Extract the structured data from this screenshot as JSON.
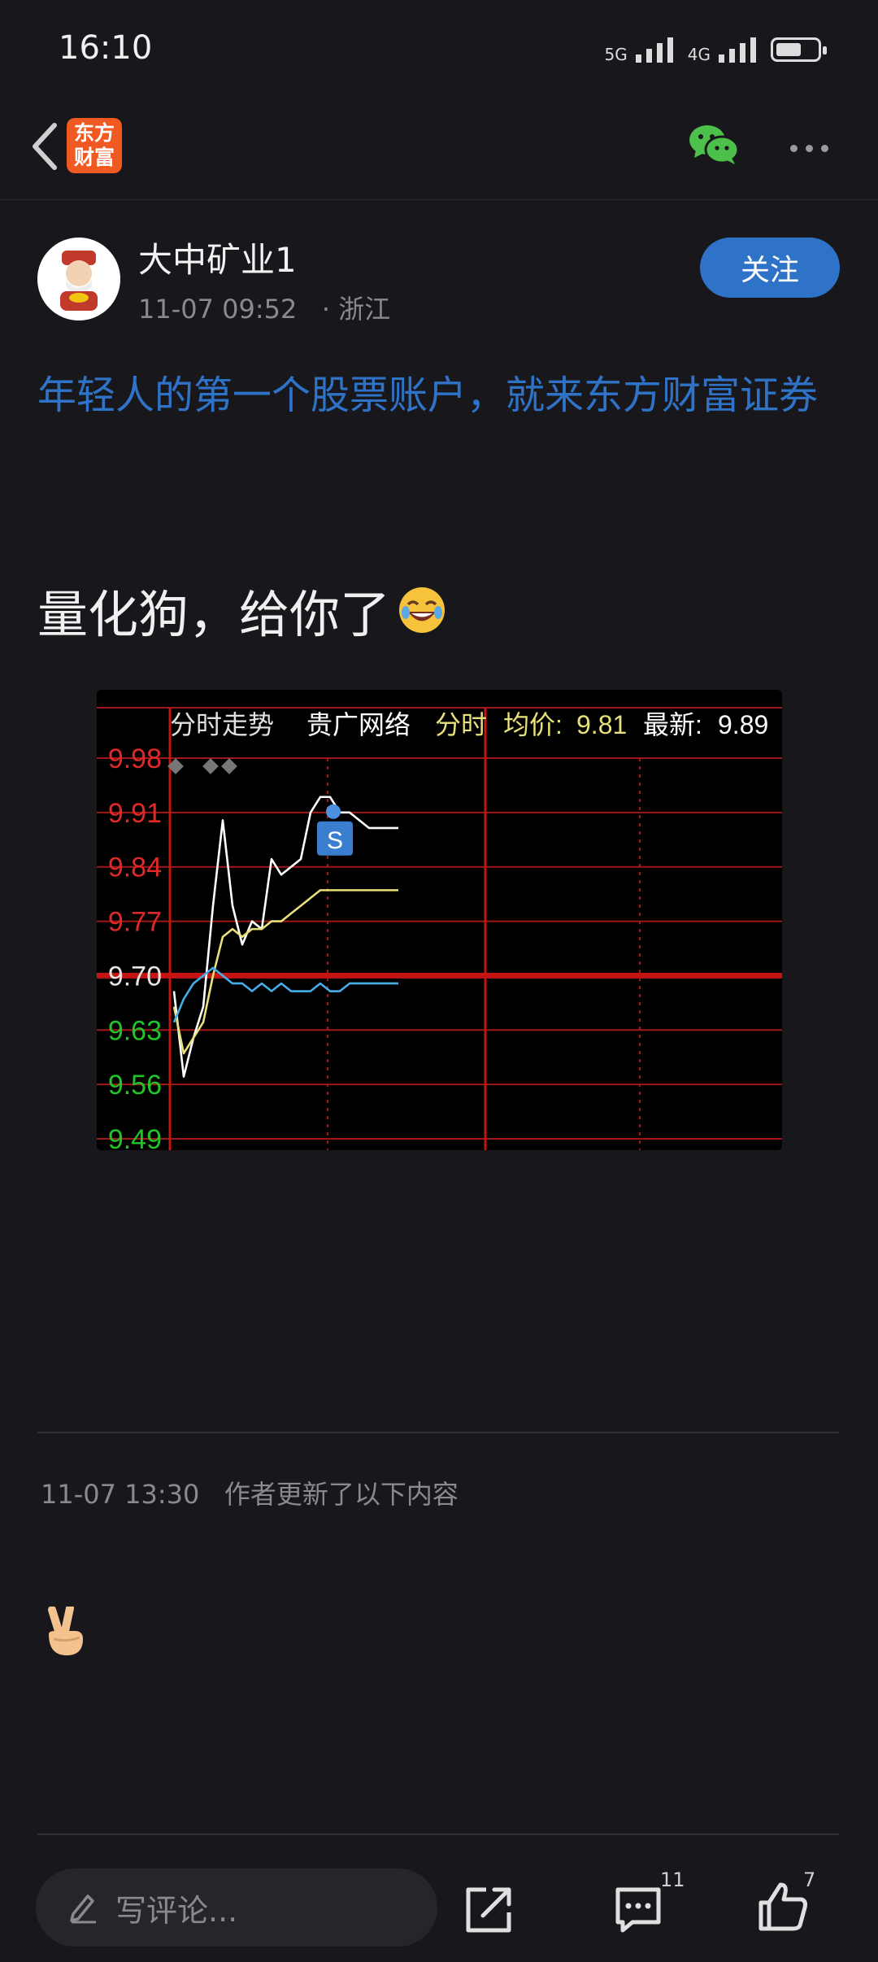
{
  "status_bar": {
    "time": "16:10",
    "signal_1_label": "5G",
    "signal_2_label": "4G",
    "battery_level": 0.6
  },
  "nav": {
    "app_logo_line1": "东方",
    "app_logo_line2": "财富",
    "icons": [
      "back-arrow-icon",
      "wechat-icon",
      "more-dots-icon"
    ]
  },
  "post": {
    "author": "大中矿业1",
    "time": "11-07 09:52",
    "location": "· 浙江",
    "follow_label": "关注",
    "ad_link": "年轻人的第一个股票账户，就来东方财富证券",
    "text": "量化狗，给你了",
    "text_emoji": "laugh-icon"
  },
  "chart_data": {
    "type": "line",
    "header_title": "分时走势",
    "stock_name": "贵广网络",
    "mode_label": "分时",
    "avg_label": "均价:",
    "avg_value": "9.81",
    "latest_label": "最新:",
    "latest_value": "9.89",
    "y_ticks": [
      "9.98",
      "9.91",
      "9.84",
      "9.77",
      "9.70",
      "9.63",
      "9.56",
      "9.49"
    ],
    "ylim": [
      9.49,
      9.98
    ],
    "reference_price": 9.7,
    "x": [
      0,
      1,
      2,
      3,
      4,
      5,
      6,
      7,
      8,
      9,
      10,
      11,
      12,
      13,
      14,
      15,
      16,
      17,
      18,
      19,
      20,
      21,
      22,
      23
    ],
    "series": [
      {
        "color": "#ffffff",
        "values": [
          9.68,
          9.57,
          9.62,
          9.66,
          9.79,
          9.9,
          9.79,
          9.74,
          9.77,
          9.76,
          9.85,
          9.83,
          9.84,
          9.85,
          9.91,
          9.93,
          9.93,
          9.91,
          9.91,
          9.9,
          9.89,
          9.89,
          9.89,
          9.89
        ]
      },
      {
        "color": "#e8e07a",
        "values": [
          9.66,
          9.6,
          9.62,
          9.64,
          9.7,
          9.75,
          9.76,
          9.75,
          9.76,
          9.76,
          9.77,
          9.77,
          9.78,
          9.79,
          9.8,
          9.81,
          9.81,
          9.81,
          9.81,
          9.81,
          9.81,
          9.81,
          9.81,
          9.81
        ]
      },
      {
        "color": "#45aee8",
        "values": [
          9.64,
          9.67,
          9.69,
          9.7,
          9.71,
          9.7,
          9.69,
          9.69,
          9.68,
          9.69,
          9.68,
          9.69,
          9.68,
          9.68,
          9.68,
          9.69,
          9.68,
          9.68,
          9.69,
          9.69,
          9.69,
          9.69,
          9.69,
          9.69
        ]
      }
    ],
    "marker_label": "S",
    "grid": true,
    "line_series_count_shown": 3
  },
  "update": {
    "time": "11-07 13:30",
    "text": "作者更新了以下内容",
    "emoji": "victory-hand-icon"
  },
  "bottom_bar": {
    "comment_placeholder": "写评论...",
    "comment_count": "11",
    "like_count": "7"
  }
}
